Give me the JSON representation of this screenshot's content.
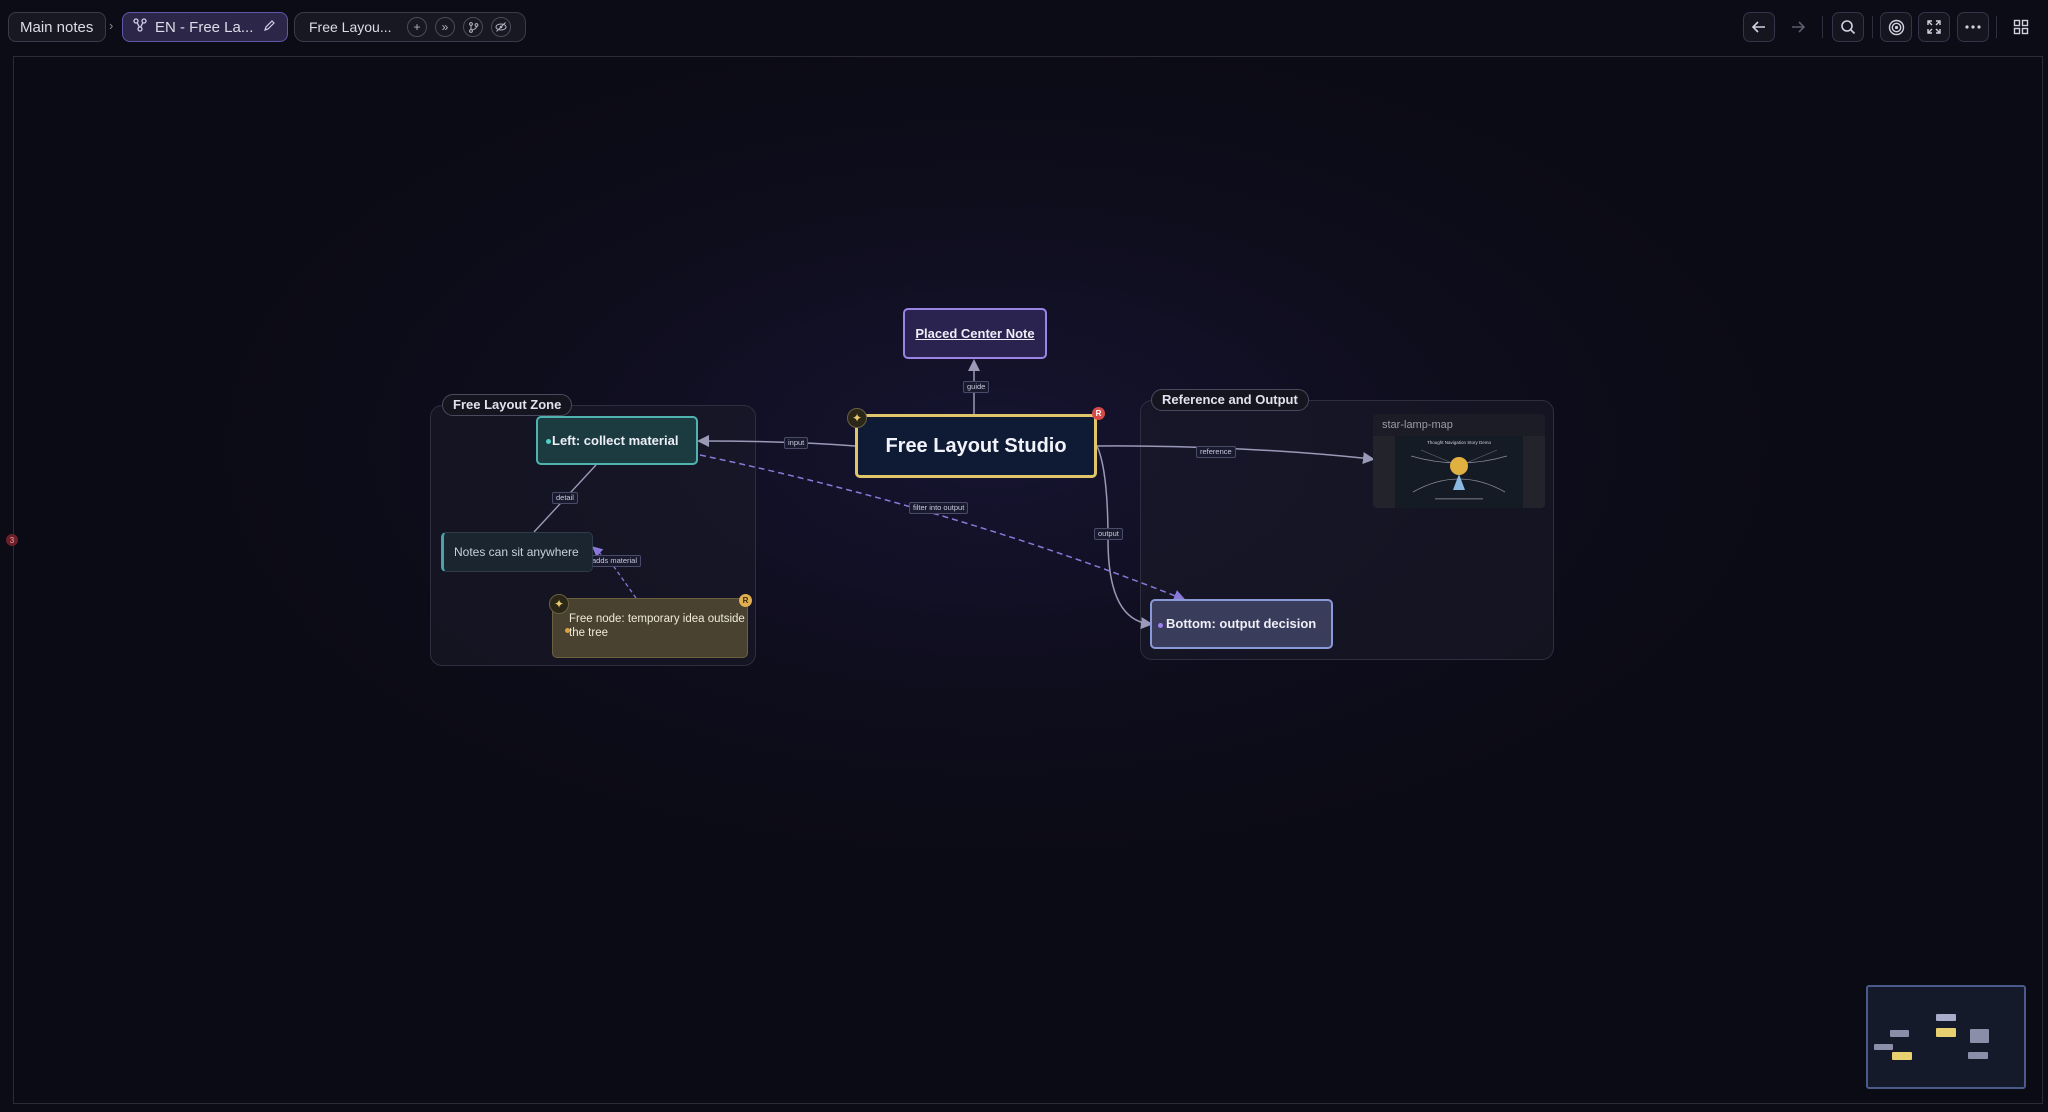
{
  "breadcrumb": {
    "main": "Main notes",
    "separator": "›",
    "doc": "EN - Free La...",
    "view": "Free Layou..."
  },
  "canvas": {
    "groups": {
      "left": "Free Layout Zone",
      "right": "Reference and Output"
    },
    "nodes": {
      "center": "Free Layout Studio",
      "placed": "Placed Center Note",
      "left": "Left: collect material",
      "notes": "Notes can sit anywhere",
      "free": "Free node: temporary idea outside the tree",
      "bottom": "Bottom: output decision"
    },
    "edges": {
      "guide": "guide",
      "input": "input",
      "reference": "reference",
      "filter": "filter into output",
      "output": "output",
      "detail": "detail",
      "adds": "adds material"
    },
    "image_card": {
      "caption": "star-lamp-map",
      "thumb_title": "Thought Navigation Story Demo"
    },
    "badges": {
      "center": "R",
      "free": "R",
      "side": "3"
    }
  },
  "colors": {
    "accent_center_border": "#e0c56a",
    "placed_border": "#9a84e6",
    "left_border": "#4fb3b0",
    "bottom_border": "#8a9ad8",
    "edge_dashed": "#8a78d8"
  }
}
